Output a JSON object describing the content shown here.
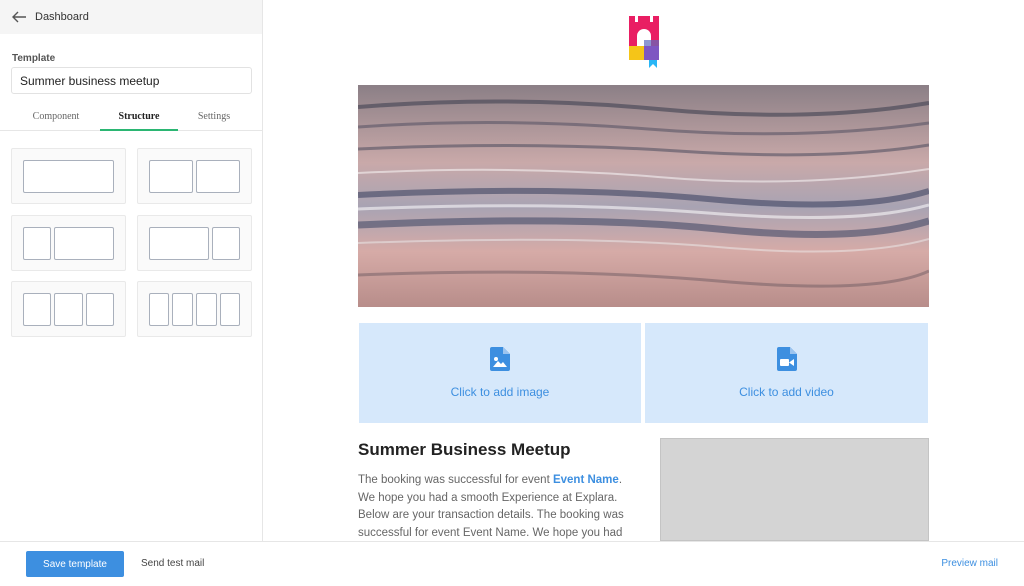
{
  "topbar": {
    "back_icon": "arrow-left-icon",
    "label": "Dashboard"
  },
  "template": {
    "label": "Template",
    "value": "Summer business meetup"
  },
  "tabs": [
    {
      "label": "Component",
      "active": false
    },
    {
      "label": "Structure",
      "active": true
    },
    {
      "label": "Settings",
      "active": false
    }
  ],
  "structures": [
    "1 column",
    "2 columns",
    "1:2 columns",
    "2:1 columns",
    "3 columns",
    "4 columns"
  ],
  "email": {
    "image_drop": {
      "label": "Click to add image",
      "icon": "image-file-icon"
    },
    "video_drop": {
      "label": "Click to add video",
      "icon": "video-file-icon"
    },
    "event_title": "Summer Business Meetup",
    "body_prefix": "The booking was successful for event ",
    "body_link": "Event Name",
    "body_suffix": ". We hope you had a smooth Experience at Explara. Below are your transaction details. The booking was successful for event Event Name. We hope you had a"
  },
  "bottom": {
    "save": "Save template",
    "send_test": "Send test mail",
    "preview": "Preview mail"
  },
  "colors": {
    "accent": "#3d8fe0",
    "tab_underline": "#2bb673",
    "drop_bg": "#d6e8fb"
  }
}
